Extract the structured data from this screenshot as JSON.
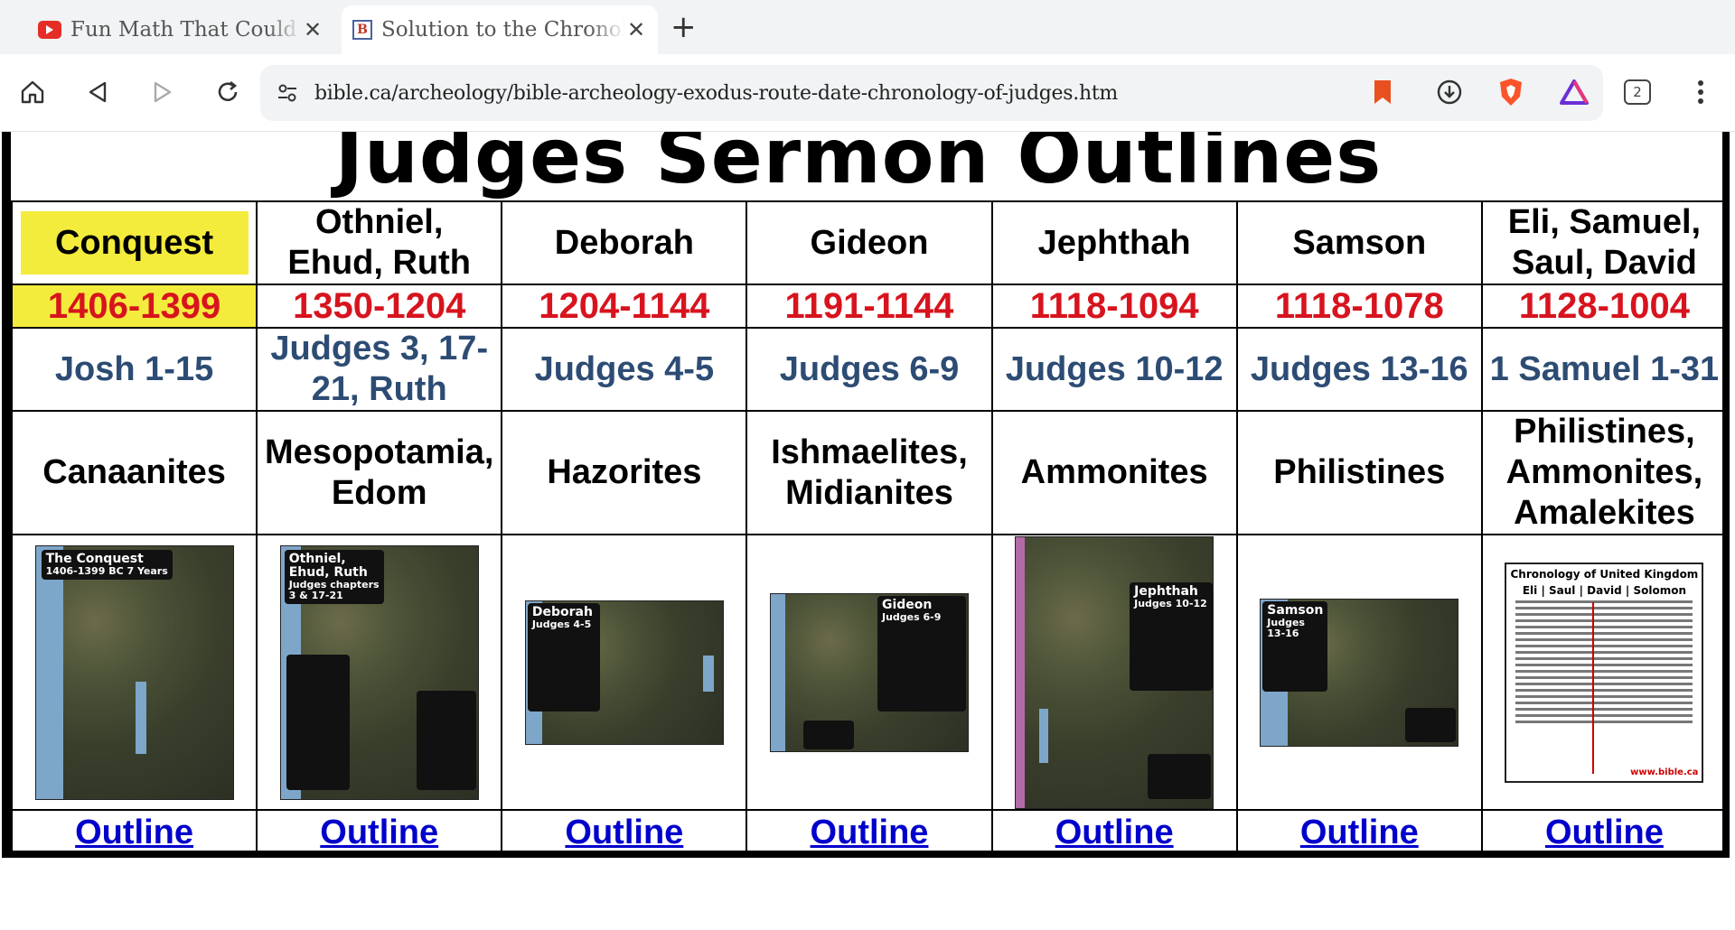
{
  "browser": {
    "tabs": [
      {
        "title": "Fun Math That Could Supp",
        "active": false,
        "favicon": "youtube-icon"
      },
      {
        "title": "Solution to the Chronology",
        "active": true,
        "favicon": "bible-ca-icon"
      }
    ],
    "url": "bible.ca/archeology/bible-archeology-exodus-route-date-chronology-of-judges.htm",
    "tab_count": "2"
  },
  "page": {
    "heading": "Judges Sermon Outlines",
    "columns": [
      {
        "name": "Conquest",
        "years": "1406-1399",
        "reference": "Josh 1-15",
        "enemies": "Canaanites",
        "map_title": "The Conquest",
        "map_sub": "1406-1399 BC 7 Years",
        "link": "Outline"
      },
      {
        "name": "Othniel, Ehud, Ruth",
        "years": "1350-1204",
        "reference": "Judges 3, 17-21, Ruth",
        "enemies": "Mesopotamia, Edom",
        "map_title": "Othniel, Ehud, Ruth",
        "map_sub": "Judges chapters 3 & 17-21",
        "link": "Outline"
      },
      {
        "name": "Deborah",
        "years": "1204-1144",
        "reference": "Judges 4-5",
        "enemies": "Hazorites",
        "map_title": "Deborah",
        "map_sub": "Judges 4-5",
        "link": "Outline"
      },
      {
        "name": "Gideon",
        "years": "1191-1144",
        "reference": "Judges 6-9",
        "enemies": "Ishmaelites, Midianites",
        "map_title": "Gideon",
        "map_sub": "Judges 6-9",
        "link": "Outline"
      },
      {
        "name": "Jephthah",
        "years": "1118-1094",
        "reference": "Judges 10-12",
        "enemies": "Ammonites",
        "map_title": "Jephthah",
        "map_sub": "Judges 10-12",
        "link": "Outline"
      },
      {
        "name": "Samson",
        "years": "1118-1078",
        "reference": "Judges 13-16",
        "enemies": "Philistines",
        "map_title": "Samson",
        "map_sub": "Judges 13-16",
        "link": "Outline"
      },
      {
        "name": "Eli, Samuel, Saul, David",
        "years": "1128-1004",
        "reference": "1 Samuel 1-31",
        "enemies": "Philistines, Ammonites, Amalekites",
        "map_title": "Chronology of United Kingdom",
        "map_sub": "Eli | Saul | David | Solomon",
        "link": "Outline"
      }
    ]
  },
  "colors": {
    "years_red": "#d7141e",
    "reference_blue": "#2d4c74",
    "highlight_yellow": "#f4ec3c",
    "link_blue": "#0000cc"
  }
}
